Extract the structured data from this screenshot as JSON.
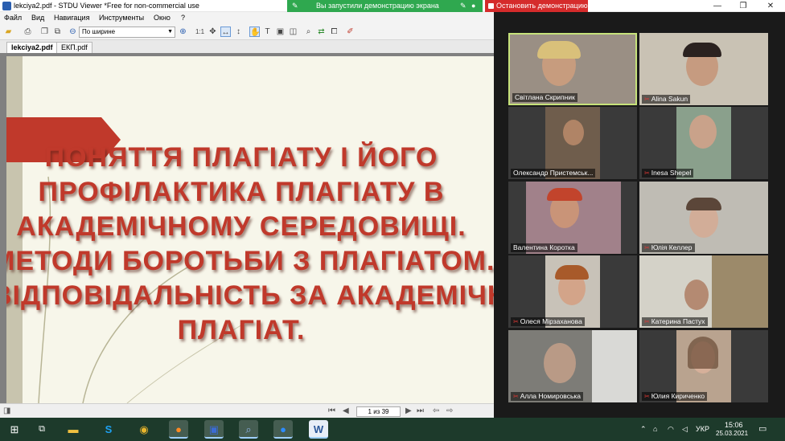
{
  "window": {
    "title": "lekciya2.pdf - STDU Viewer *Free for non-commercial use",
    "controls": {
      "minimize": "—",
      "restore": "❐",
      "close": "✕"
    }
  },
  "share_bar": {
    "message": "Вы запустили демонстрацию экрана",
    "stop_label": "Остановить демонстрацию"
  },
  "menu": [
    "Файл",
    "Вид",
    "Навигация",
    "Инструменты",
    "Окно",
    "?"
  ],
  "toolbar": {
    "zoom_mode": "По ширине",
    "scale_label": "1:1"
  },
  "tabs": [
    {
      "label": "lekciya2.pdf",
      "active": true
    },
    {
      "label": "ЕКП.pdf",
      "active": false
    }
  ],
  "slide": {
    "lines": [
      "ПОНЯТТЯ ПЛАГІАТУ І ЙОГО",
      "ПРОФІЛАКТИКА ПЛАГІАТУ В",
      "АКАДЕМІЧНОМУ СЕРЕДОВИЩІ.",
      "МЕТОДИ БОРОТЬБИ З ПЛАГІАТОМ.",
      "ВІДПОВІДАЛЬНІСТЬ ЗА АКАДЕМІЧНИЙ",
      "ПЛАГІАТ."
    ],
    "title_color": "#c0392b",
    "accent_color": "#c0392b"
  },
  "navigation": {
    "page_text": "1 из 39"
  },
  "participants": [
    {
      "name": "Світлана Скрипник",
      "muted": false,
      "active": true
    },
    {
      "name": "Alina Sakun",
      "muted": true,
      "active": false
    },
    {
      "name": "Олександр Пристемськ...",
      "muted": false,
      "active": false
    },
    {
      "name": "Inesa Shepel",
      "muted": true,
      "active": false
    },
    {
      "name": "Валентина Коротка",
      "muted": false,
      "active": false
    },
    {
      "name": "Юлія Келлер",
      "muted": true,
      "active": false
    },
    {
      "name": "Олеся Мірзаханова",
      "muted": true,
      "active": false
    },
    {
      "name": "Катерина Пастух",
      "muted": true,
      "active": false
    },
    {
      "name": "Алла Номировська",
      "muted": true,
      "active": false
    },
    {
      "name": "Юлия Кириченко",
      "muted": true,
      "active": false
    }
  ],
  "taskbar": {
    "apps": [
      "start-icon",
      "task-view-icon",
      "file-explorer-icon",
      "skype-icon",
      "chrome-icon",
      "firefox-icon",
      "save-disk-icon",
      "magnifier-icon",
      "zoom-icon",
      "word-icon"
    ],
    "tray": {
      "language": "УКР",
      "time": "15:06",
      "date": "25.03.2021"
    }
  }
}
